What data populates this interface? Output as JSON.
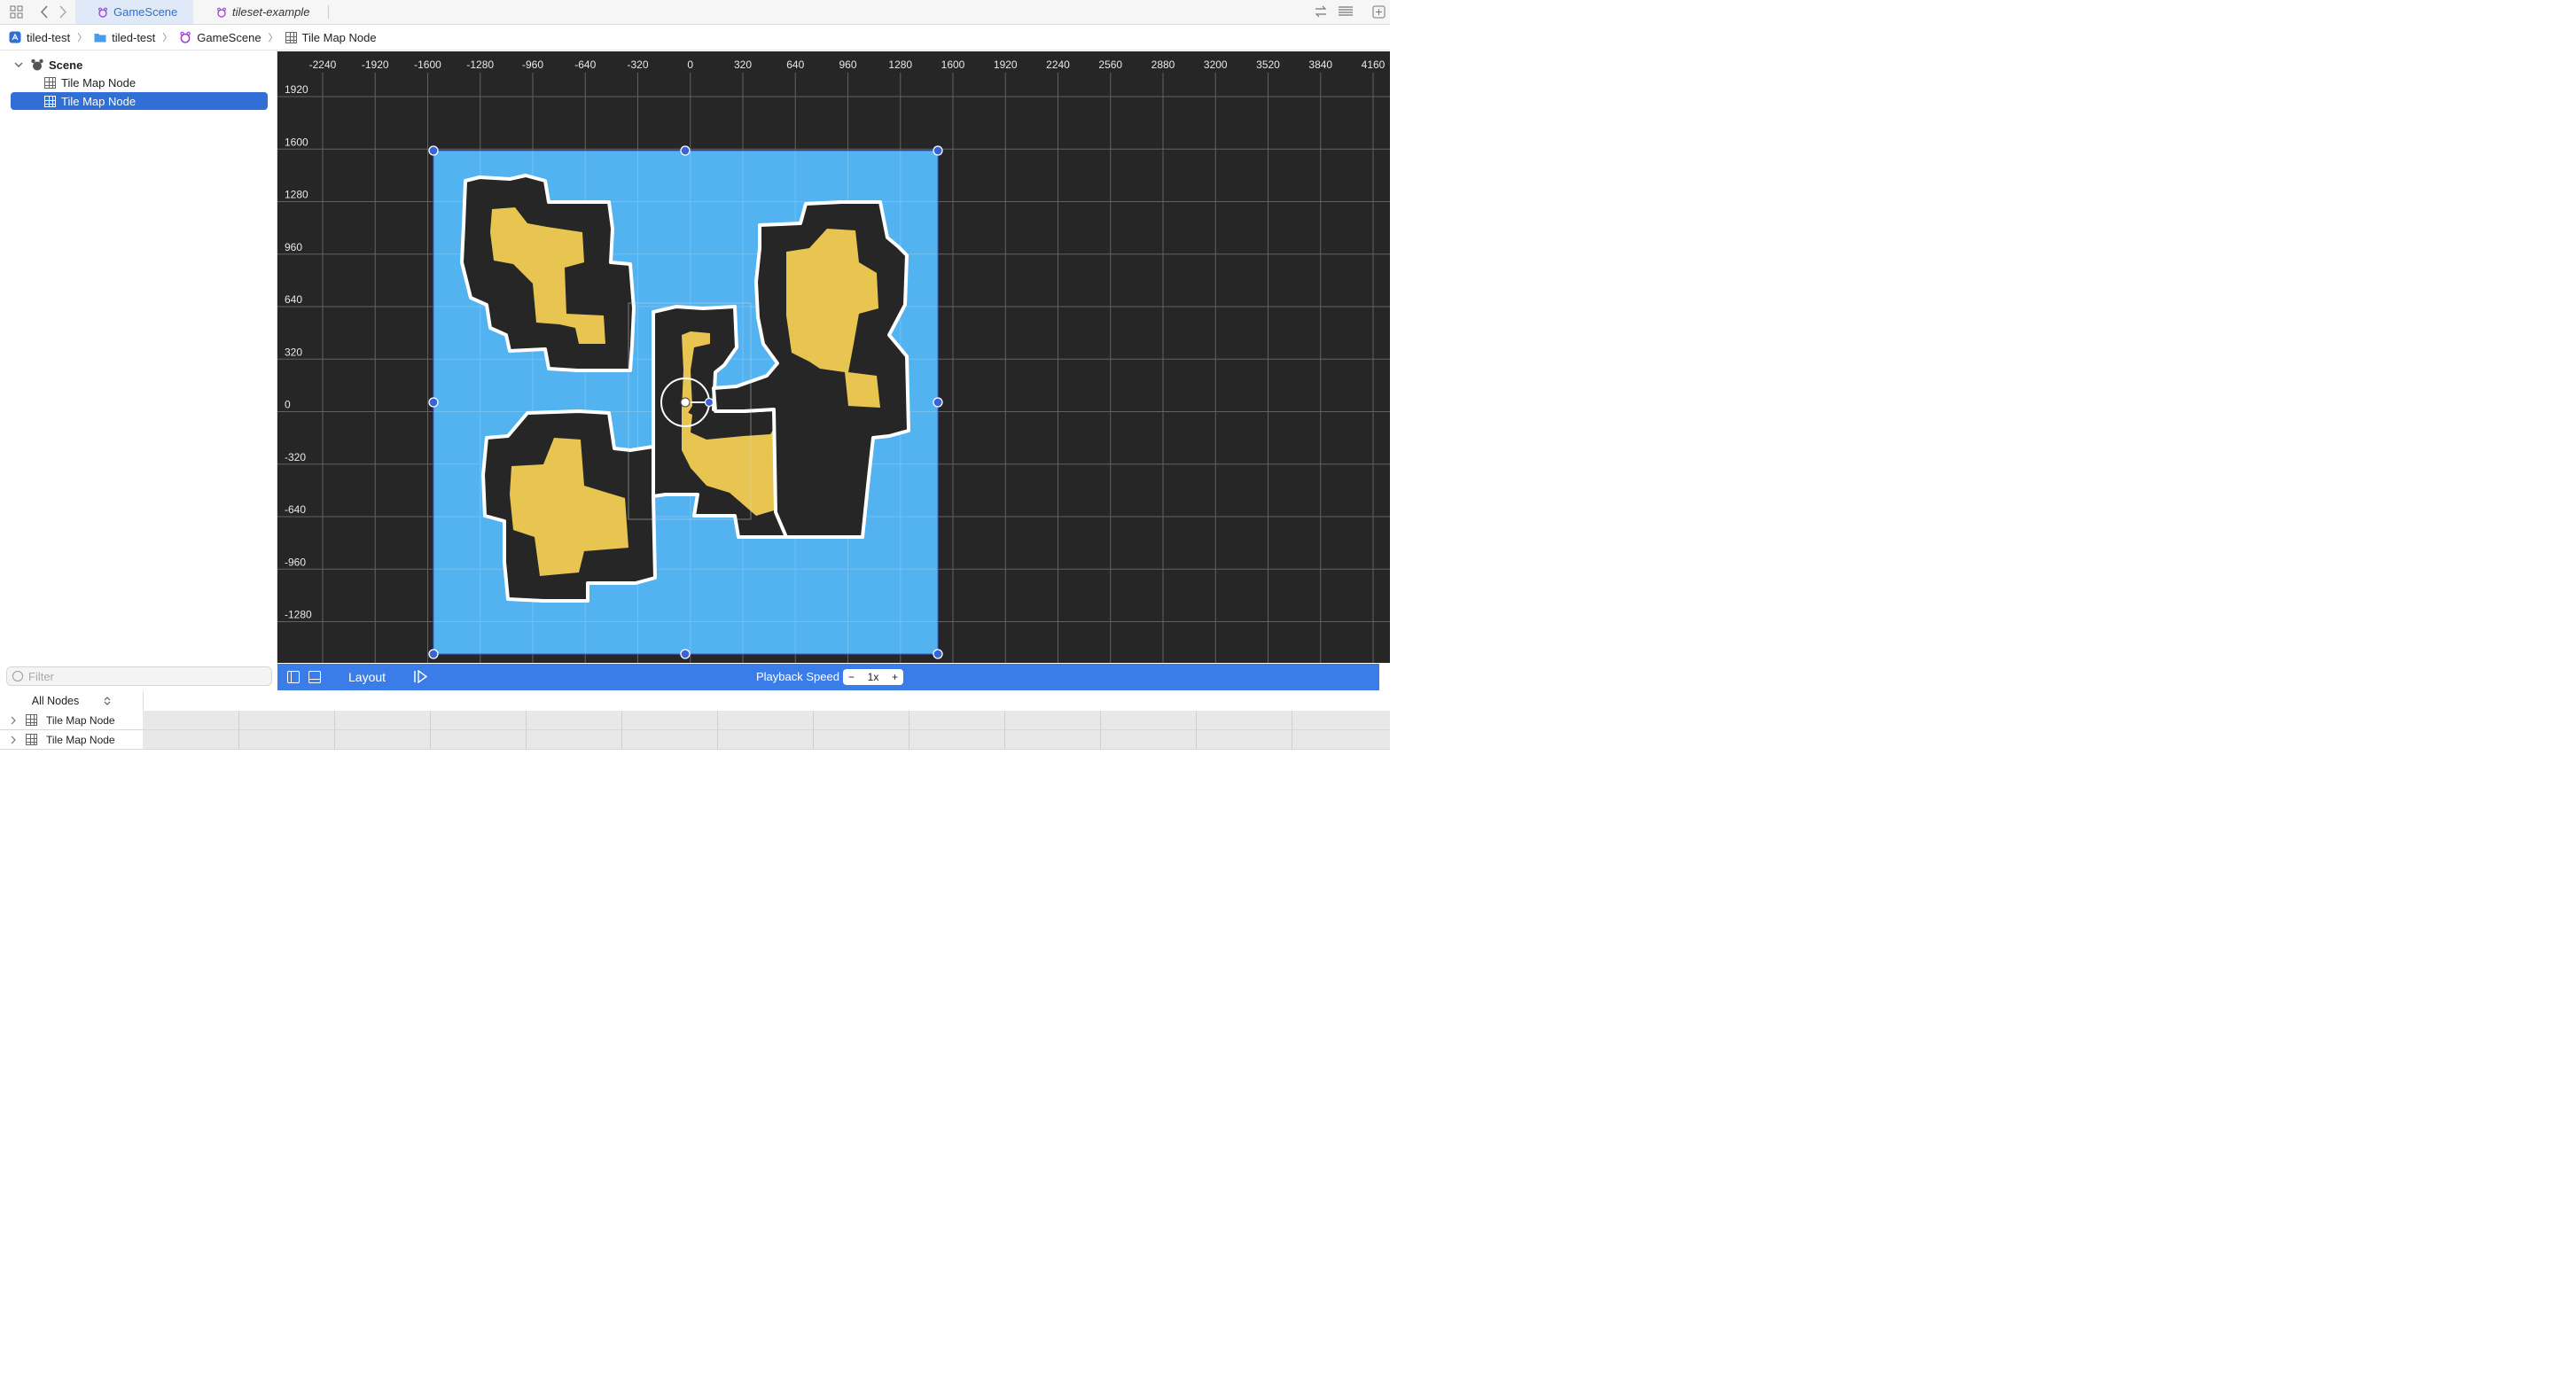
{
  "tabs": [
    {
      "label": "GameScene",
      "active": true
    },
    {
      "label": "tileset-example",
      "active": false
    }
  ],
  "breadcrumb": [
    "tiled-test",
    "tiled-test",
    "GameScene",
    "Tile Map Node"
  ],
  "outline": {
    "root": "Scene",
    "children": [
      "Tile Map Node",
      "Tile Map Node"
    ],
    "selected_index": 1
  },
  "filter_placeholder": "Filter",
  "canvas": {
    "x_ruler": [
      "-2240",
      "-1920",
      "-1600",
      "-1280",
      "-960",
      "-640",
      "-320",
      "0",
      "320",
      "640",
      "960",
      "1280",
      "1600",
      "1920",
      "2240",
      "2560",
      "2880",
      "3200",
      "3520",
      "3840",
      "4160"
    ],
    "y_ruler": [
      "1920",
      "1600",
      "1280",
      "960",
      "640",
      "320",
      "0",
      "-320",
      "-640",
      "-960",
      "-1280"
    ],
    "colors": {
      "background": "#262626",
      "water": "#52b3f0",
      "land": "#262626",
      "sand": "#e8c550",
      "shore": "#ffffff",
      "handle": "#3a63d8"
    }
  },
  "bottombar": {
    "layout_label": "Layout",
    "playback_label": "Playback Speed",
    "speed_value": "1x",
    "minus": "−",
    "plus": "+"
  },
  "timeline": {
    "filter_label": "All Nodes",
    "rows": [
      "Tile Map Node",
      "Tile Map Node"
    ]
  }
}
